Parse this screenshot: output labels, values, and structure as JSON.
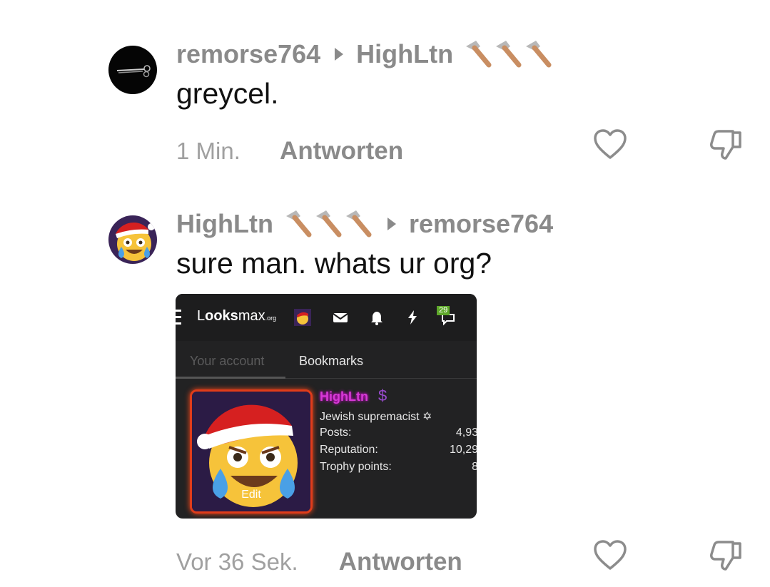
{
  "comments": [
    {
      "author": "remorse764",
      "reply_to": "HighLtn",
      "text": "greycel.",
      "time": "1 Min.",
      "reply_label": "Antworten"
    },
    {
      "author": "HighLtn",
      "reply_to": "remorse764",
      "text": "sure man. whats ur org?",
      "time": "Vor 36 Sek.",
      "reply_label": "Antworten",
      "attachment": {
        "site_logo_main": "L",
        "site_logo_bold": "ooks",
        "site_logo_rest": "max",
        "site_logo_tld": ".org",
        "alerts_badge": "29",
        "tabs": [
          "Your account",
          "Bookmarks"
        ],
        "edit_label": "Edit",
        "username": "HighLtn",
        "user_title": "Jewish supremacist ✡",
        "stats": [
          {
            "label": "Posts:",
            "value": "4,93"
          },
          {
            "label": "Reputation:",
            "value": "10,29"
          },
          {
            "label": "Trophy points:",
            "value": "8"
          }
        ]
      }
    }
  ],
  "icons": [
    "hammer-icon",
    "heart-icon",
    "thumbs-down-icon",
    "play-arrow-icon"
  ],
  "colors": {
    "username_gray": "#8a8a8a",
    "text": "#111111",
    "dark_panel": "#222223"
  }
}
